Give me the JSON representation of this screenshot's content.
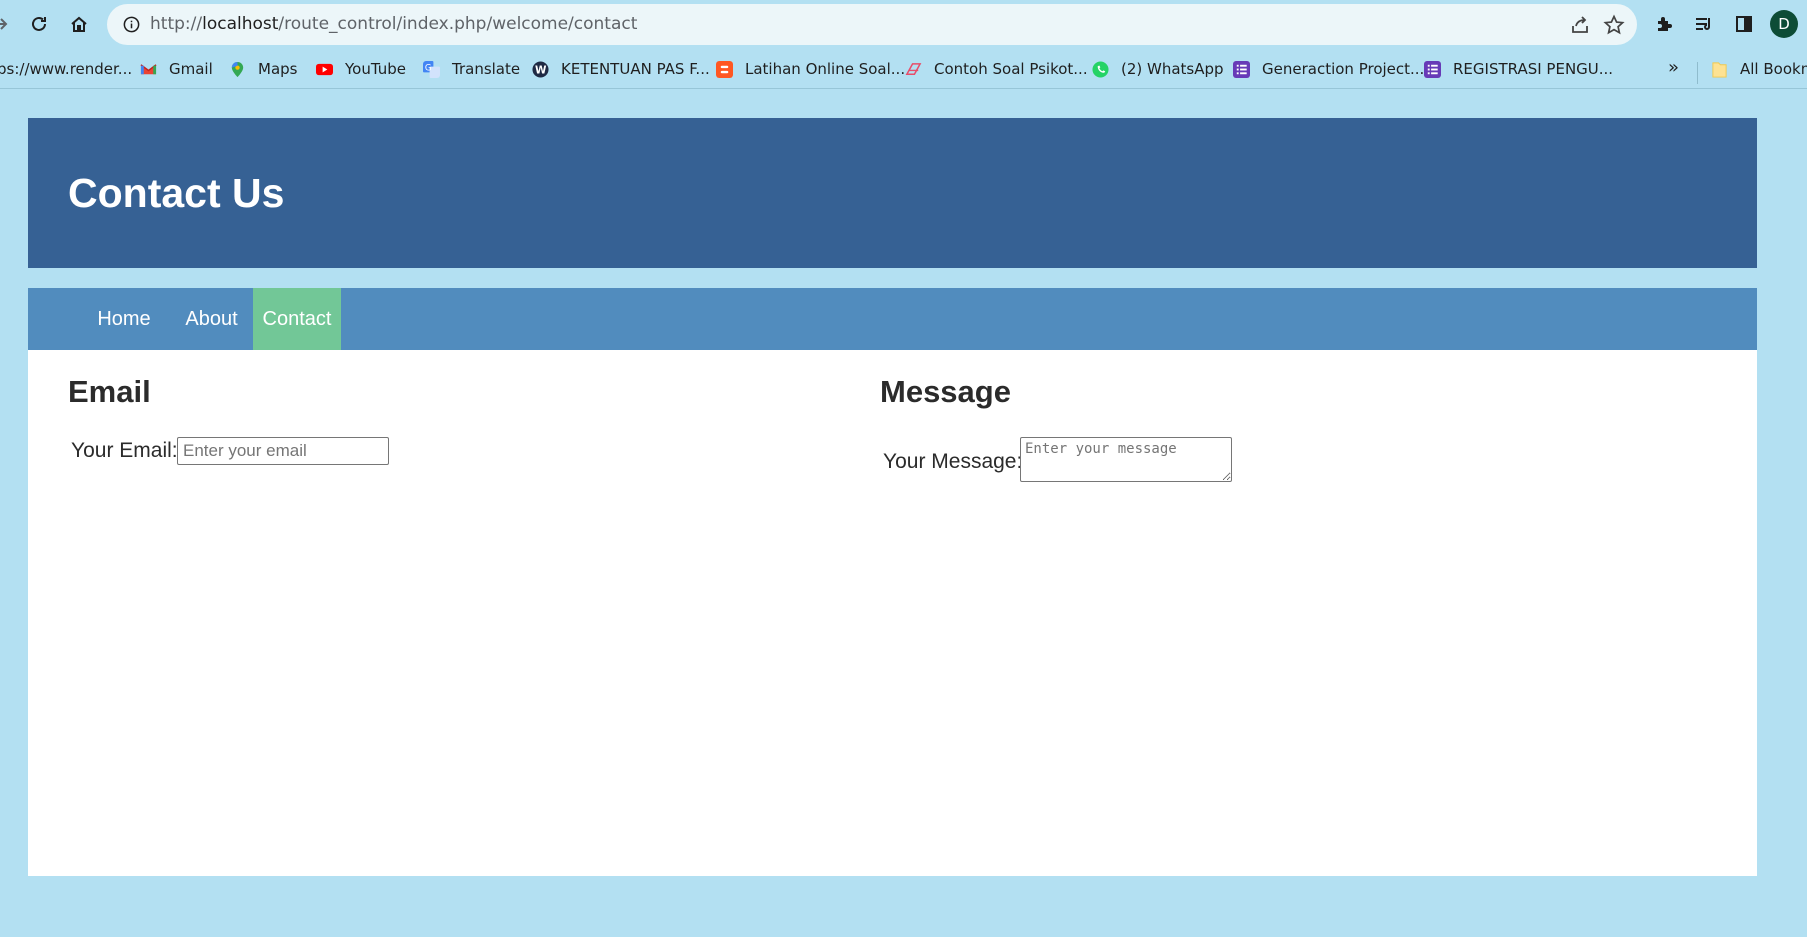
{
  "browser": {
    "url_prefix": "http://",
    "url_host": "localhost",
    "url_path": "/route_control/index.php/welcome/contact",
    "avatar_letter": "D",
    "bookmarks": [
      {
        "label": "ps://www.render...",
        "icon": "none"
      },
      {
        "label": "Gmail",
        "icon": "gmail-icon"
      },
      {
        "label": "Maps",
        "icon": "maps-icon"
      },
      {
        "label": "YouTube",
        "icon": "youtube-icon"
      },
      {
        "label": "Translate",
        "icon": "translate-icon"
      },
      {
        "label": "KETENTUAN PAS F...",
        "icon": "wordpress-icon"
      },
      {
        "label": "Latihan Online Soal...",
        "icon": "blogger-icon"
      },
      {
        "label": "Contoh Soal Psikot...",
        "icon": "site-icon"
      },
      {
        "label": "(2) WhatsApp",
        "icon": "whatsapp-icon"
      },
      {
        "label": "Generaction Project...",
        "icon": "forms-icon"
      },
      {
        "label": "REGISTRASI PENGU...",
        "icon": "forms-icon"
      },
      {
        "label": "All Bookm",
        "icon": "folder-icon"
      }
    ],
    "more_label": "»",
    "colors": {
      "chrome_bg": "#b3e0f2",
      "omnibox_bg": "#ecf6f9",
      "avatar_bg": "#0d4c36"
    }
  },
  "page": {
    "header_title": "Contact Us",
    "nav": [
      {
        "label": "Home",
        "active": false
      },
      {
        "label": "About",
        "active": false
      },
      {
        "label": "Contact",
        "active": true
      }
    ],
    "email_section": {
      "title": "Email",
      "label": "Your Email:",
      "placeholder": "Enter your email",
      "value": ""
    },
    "message_section": {
      "title": "Message",
      "label": "Your Message:",
      "placeholder": "Enter your message",
      "value": ""
    },
    "colors": {
      "header_bg": "#366194",
      "nav_bg": "#518cbe",
      "nav_active_bg": "#72c797",
      "content_bg": "#ffffff",
      "page_bg": "#b3e0f2"
    }
  }
}
